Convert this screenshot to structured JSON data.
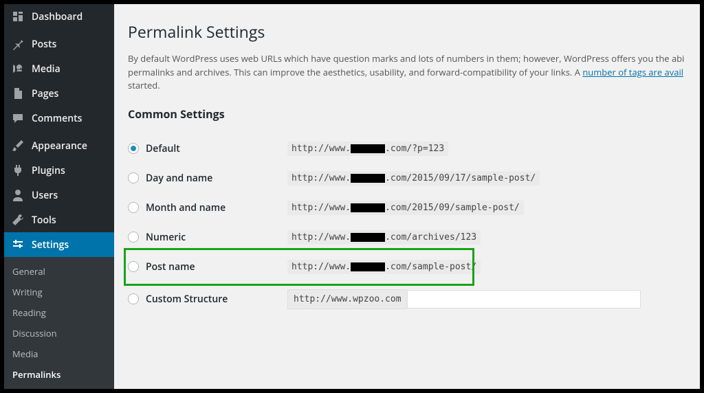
{
  "sidebar": {
    "items": [
      {
        "label": "Dashboard",
        "icon": "dashboard"
      },
      {
        "label": "Posts",
        "icon": "pin"
      },
      {
        "label": "Media",
        "icon": "media"
      },
      {
        "label": "Pages",
        "icon": "page"
      },
      {
        "label": "Comments",
        "icon": "comment"
      },
      {
        "label": "Appearance",
        "icon": "brush"
      },
      {
        "label": "Plugins",
        "icon": "plug"
      },
      {
        "label": "Users",
        "icon": "user"
      },
      {
        "label": "Tools",
        "icon": "wrench"
      },
      {
        "label": "Settings",
        "icon": "sliders"
      }
    ],
    "submenu": [
      {
        "label": "General"
      },
      {
        "label": "Writing"
      },
      {
        "label": "Reading"
      },
      {
        "label": "Discussion"
      },
      {
        "label": "Media"
      },
      {
        "label": "Permalinks"
      }
    ]
  },
  "page": {
    "title": "Permalink Settings",
    "desc_a": "By default WordPress uses web URLs which have question marks and lots of numbers in them; however, WordPress offers you the abi",
    "desc_b": "permalinks and archives. This can improve the aesthetics, usability, and forward-compatibility of your links. A ",
    "desc_link": "number of tags are avail",
    "desc_c": "started.",
    "section": "Common Settings"
  },
  "options": [
    {
      "label": "Default",
      "pre": "http://www.",
      "post": ".com/?p=123",
      "checked": true,
      "redact": true
    },
    {
      "label": "Day and name",
      "pre": "http://www.",
      "post": ".com/2015/09/17/sample-post/",
      "checked": false,
      "redact": true
    },
    {
      "label": "Month and name",
      "pre": "http://www.",
      "post": ".com/2015/09/sample-post/",
      "checked": false,
      "redact": true
    },
    {
      "label": "Numeric",
      "pre": "http://www.",
      "post": ".com/archives/123",
      "checked": false,
      "redact": true
    },
    {
      "label": "Post name",
      "pre": "http://www.",
      "post": ".com/sample-post/",
      "checked": false,
      "redact": true
    },
    {
      "label": "Custom Structure",
      "pre": "http://www.wpzoo.com",
      "post": "",
      "checked": false,
      "redact": false,
      "input": ""
    }
  ]
}
